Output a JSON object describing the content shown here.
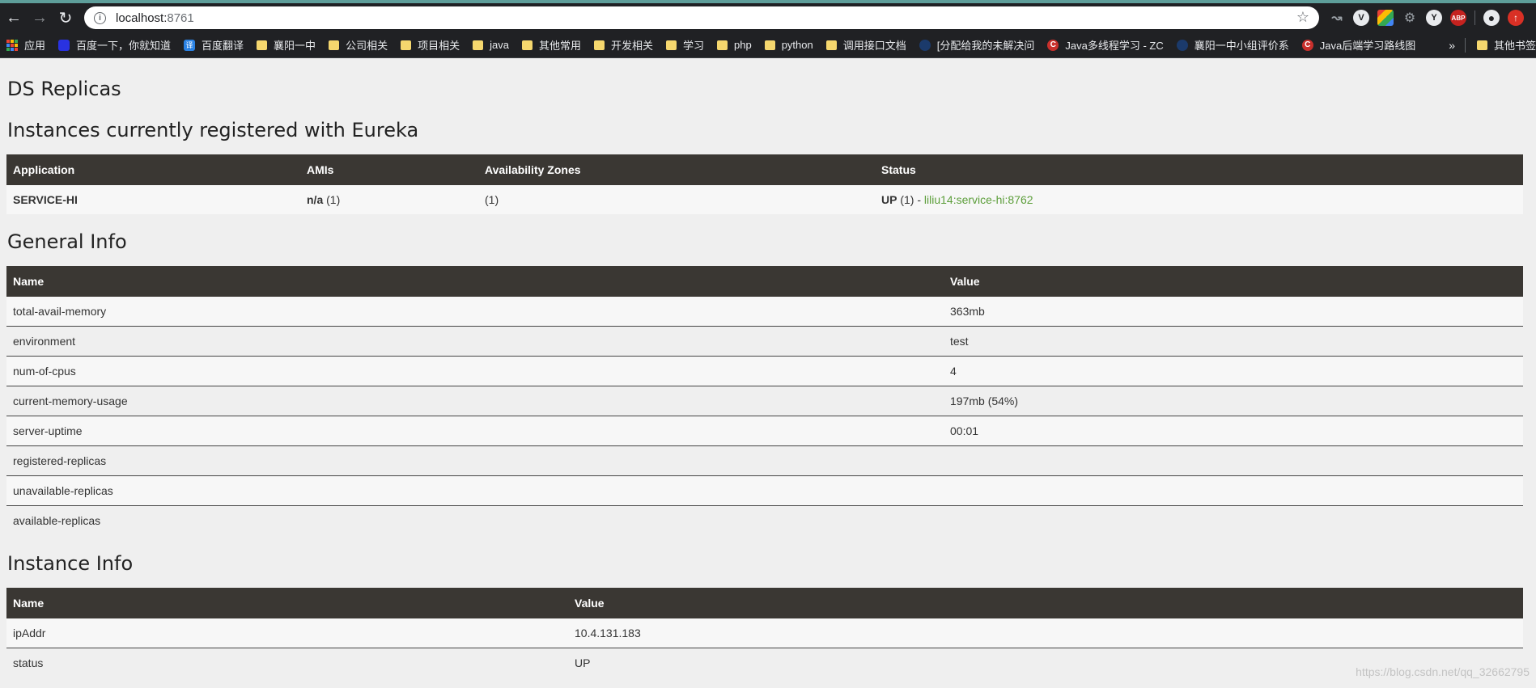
{
  "browser": {
    "url_host": "localhost:",
    "url_port": "8761",
    "bookmarks": [
      {
        "label": "应用",
        "icon": "apps-icon"
      },
      {
        "label": "百度一下，你就知道",
        "icon": "baidu-icon"
      },
      {
        "label": "百度翻译",
        "icon": "translate-icon"
      },
      {
        "label": "襄阳一中",
        "icon": "folder-icon"
      },
      {
        "label": "公司相关",
        "icon": "folder-icon"
      },
      {
        "label": "项目相关",
        "icon": "folder-icon"
      },
      {
        "label": "java",
        "icon": "folder-icon"
      },
      {
        "label": "其他常用",
        "icon": "folder-icon"
      },
      {
        "label": "开发相关",
        "icon": "folder-icon"
      },
      {
        "label": "学习",
        "icon": "folder-icon"
      },
      {
        "label": "php",
        "icon": "folder-icon"
      },
      {
        "label": "python",
        "icon": "folder-icon"
      },
      {
        "label": "调用接口文档",
        "icon": "folder-icon"
      },
      {
        "label": "[分配给我的未解决问",
        "icon": "jira-icon"
      },
      {
        "label": "Java多线程学习 - ZC",
        "icon": "csdn-icon"
      },
      {
        "label": "襄阳一中小组评价系",
        "icon": "jira-icon"
      },
      {
        "label": "Java后端学习路线图",
        "icon": "csdn-icon"
      }
    ],
    "more_label": "»",
    "other_bookmarks": "其他书签"
  },
  "page": {
    "ds_replicas_title": "DS Replicas",
    "instances_title": "Instances currently registered with Eureka",
    "instances_headers": [
      "Application",
      "AMIs",
      "Availability Zones",
      "Status"
    ],
    "instances": [
      {
        "application": "SERVICE-HI",
        "ami_bold": "n/a",
        "ami_count": " (1)",
        "zones": "(1)",
        "status_bold": "UP",
        "status_count": " (1) - ",
        "status_link": "liliu14:service-hi:8762"
      }
    ],
    "general_title": "General Info",
    "general_headers": [
      "Name",
      "Value"
    ],
    "general_rows": [
      {
        "name": "total-avail-memory",
        "value": "363mb"
      },
      {
        "name": "environment",
        "value": "test"
      },
      {
        "name": "num-of-cpus",
        "value": "4"
      },
      {
        "name": "current-memory-usage",
        "value": "197mb (54%)"
      },
      {
        "name": "server-uptime",
        "value": "00:01"
      },
      {
        "name": "registered-replicas",
        "value": ""
      },
      {
        "name": "unavailable-replicas",
        "value": ""
      },
      {
        "name": "available-replicas",
        "value": ""
      }
    ],
    "instance_info_title": "Instance Info",
    "instance_headers": [
      "Name",
      "Value"
    ],
    "instance_rows": [
      {
        "name": "ipAddr",
        "value": "10.4.131.183"
      },
      {
        "name": "status",
        "value": "UP"
      }
    ]
  },
  "watermark": "https://blog.csdn.net/qq_32662795"
}
